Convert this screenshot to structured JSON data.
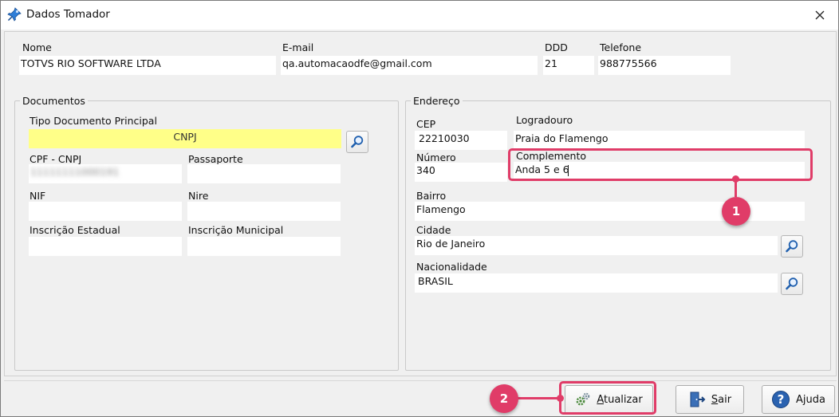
{
  "window": {
    "title": "Dados Tomador"
  },
  "header": {
    "nome_label": "Nome",
    "nome_value": "TOTVS RIO SOFTWARE LTDA",
    "email_label": "E-mail",
    "email_value": "qa.automacaodfe@gmail.com",
    "ddd_label": "DDD",
    "ddd_value": "21",
    "telefone_label": "Telefone",
    "telefone_value": "988775566"
  },
  "documentos": {
    "legend": "Documentos",
    "tipo_label": "Tipo Documento Principal",
    "tipo_value": "CNPJ",
    "cpf_label": "CPF - CNPJ",
    "cpf_value": "11111111000191",
    "passaporte_label": "Passaporte",
    "passaporte_value": "",
    "nif_label": "NIF",
    "nif_value": "",
    "nire_label": "Nire",
    "nire_value": "",
    "ie_label": "Inscrição Estadual",
    "ie_value": "",
    "im_label": "Inscrição Municipal",
    "im_value": ""
  },
  "endereco": {
    "legend": "Endereço",
    "cep_label": "CEP",
    "cep_value": "22210030",
    "logradouro_label": "Logradouro",
    "logradouro_value": "Praia do Flamengo",
    "numero_label": "Número",
    "numero_value": "340",
    "complemento_label": "Complemento",
    "complemento_value": "Anda 5 e 6",
    "bairro_label": "Bairro",
    "bairro_value": "Flamengo",
    "cidade_label": "Cidade",
    "cidade_value": "Rio de Janeiro",
    "nacionalidade_label": "Nacionalidade",
    "nacionalidade_value": "BRASIL"
  },
  "buttons": {
    "atualizar": "Atualizar",
    "sair": "Sair",
    "ajuda": "Ajuda"
  },
  "callouts": {
    "one": "1",
    "two": "2"
  },
  "colors": {
    "accent_highlight": "#e03c68",
    "yellow_field": "#ffff88"
  }
}
